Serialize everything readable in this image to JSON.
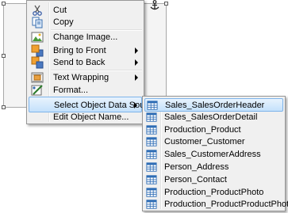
{
  "context_menu": {
    "items": [
      {
        "label": "Cut",
        "icon": "cut-icon",
        "submenu": false
      },
      {
        "label": "Copy",
        "icon": "copy-icon",
        "submenu": false
      },
      {
        "label": "Change Image...",
        "icon": "change-image-icon",
        "submenu": false
      },
      {
        "label": "Bring to Front",
        "icon": "bring-to-front-icon",
        "submenu": true
      },
      {
        "label": "Send to Back",
        "icon": "send-to-back-icon",
        "submenu": true
      },
      {
        "label": "Text Wrapping",
        "icon": "text-wrapping-icon",
        "submenu": true
      },
      {
        "label": "Format...",
        "icon": "format-icon",
        "submenu": false
      },
      {
        "label": "Select Object Data Source",
        "icon": "",
        "submenu": true,
        "highlighted": true
      },
      {
        "label": "Edit Object Name...",
        "icon": "",
        "submenu": false
      }
    ]
  },
  "data_source_submenu": {
    "items": [
      {
        "label": "Sales_SalesOrderHeader",
        "highlighted": true
      },
      {
        "label": "Sales_SalesOrderDetail"
      },
      {
        "label": "Production_Product"
      },
      {
        "label": "Customer_Customer"
      },
      {
        "label": "Sales_CustomerAddress"
      },
      {
        "label": "Person_Address"
      },
      {
        "label": "Person_Contact"
      },
      {
        "label": "Production_ProductPhoto"
      },
      {
        "label": "Production_ProductProductPhoto"
      }
    ],
    "item_icon": "table-icon"
  },
  "colors": {
    "highlight_border": "#7eb4ea",
    "menu_background": "#f0f0f0",
    "table_icon": "#2f6db5"
  }
}
